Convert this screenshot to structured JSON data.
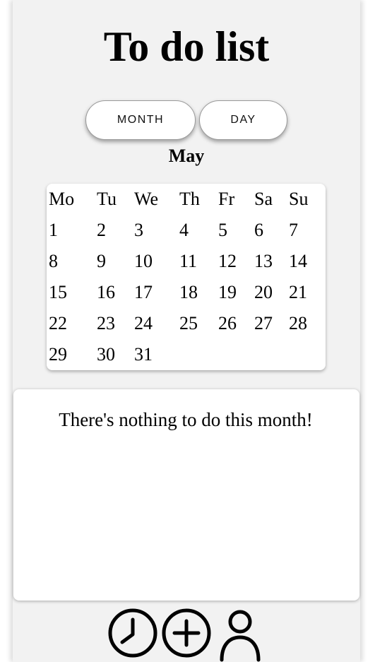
{
  "header": {
    "title": "To do list"
  },
  "view_toggle": {
    "month_label": "MONTH",
    "day_label": "DAY"
  },
  "calendar": {
    "month": "May",
    "weekdays": [
      "Mo",
      "Tu",
      "We",
      "Th",
      "Fr",
      "Sa",
      "Su"
    ],
    "weeks": [
      [
        "1",
        "2",
        "3",
        "4",
        "5",
        "6",
        "7"
      ],
      [
        "8",
        "9",
        "10",
        "11",
        "12",
        "13",
        "14"
      ],
      [
        "15",
        "16",
        "17",
        "18",
        "19",
        "20",
        "21"
      ],
      [
        "22",
        "23",
        "24",
        "25",
        "26",
        "27",
        "28"
      ],
      [
        "29",
        "30",
        "31"
      ]
    ]
  },
  "tasks": {
    "empty_message": "There's nothing to do this month!"
  },
  "bottom_nav": {
    "icons": [
      "clock-icon",
      "add-circle-icon",
      "user-icon"
    ]
  }
}
